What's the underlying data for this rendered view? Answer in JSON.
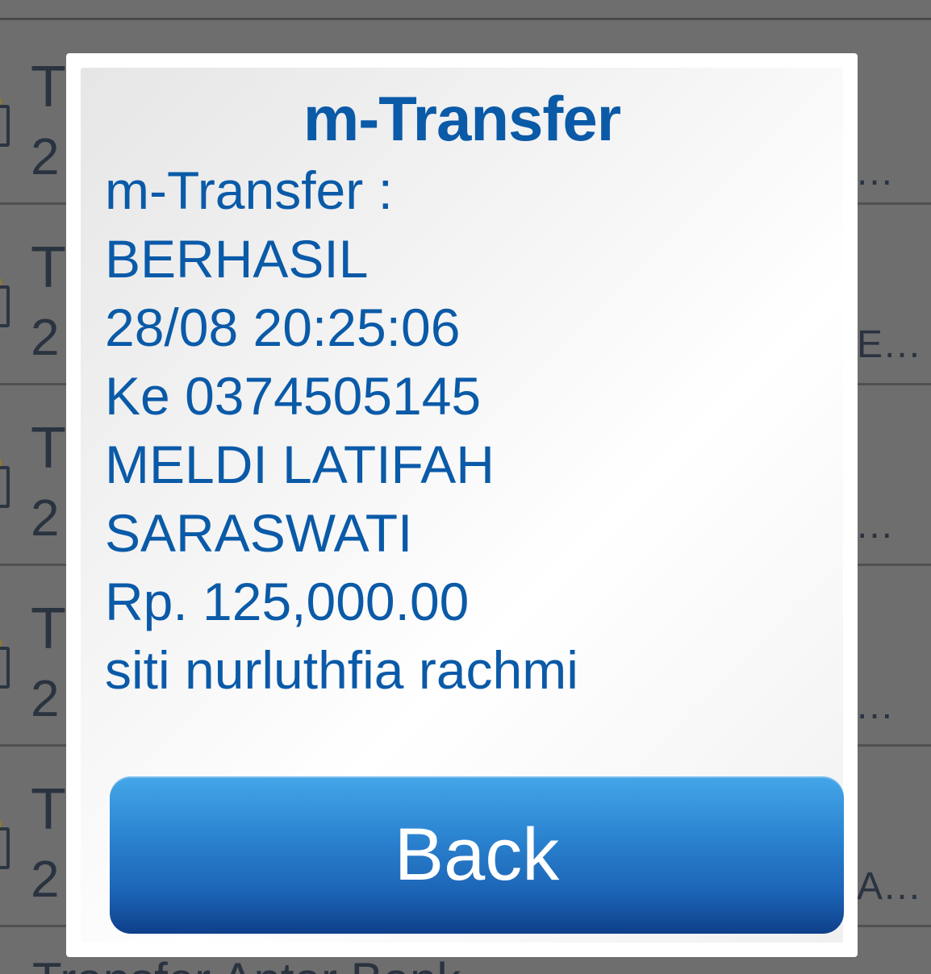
{
  "background_list": {
    "rows": [
      {
        "title_fragment": "Tr",
        "date_fragment": "2",
        "tail": "..."
      },
      {
        "title_fragment": "Tr",
        "date_fragment": "2",
        "tail": "E..."
      },
      {
        "title_fragment": "Tr",
        "date_fragment": "2",
        "tail": "..."
      },
      {
        "title_fragment": "Tr",
        "date_fragment": "2",
        "tail": "..."
      },
      {
        "title_fragment": "Tr",
        "date_fragment": "2",
        "tail": "A..."
      }
    ],
    "bottom_fragment": "Transfer Antar Bank"
  },
  "dialog": {
    "title": "m-Transfer",
    "message_lines": [
      "m-Transfer :",
      "BERHASIL",
      "28/08 20:25:06",
      "Ke 0374505145",
      "MELDI LATIFAH",
      "SARASWATI",
      "Rp. 125,000.00",
      "siti nurluthfia rachmi"
    ],
    "back_label": "Back"
  },
  "colors": {
    "title_blue": "#0a5aa8",
    "button_top": "#44a6e8",
    "button_bottom": "#0e3f8a",
    "overlay_gray": "#6e6e6e"
  }
}
